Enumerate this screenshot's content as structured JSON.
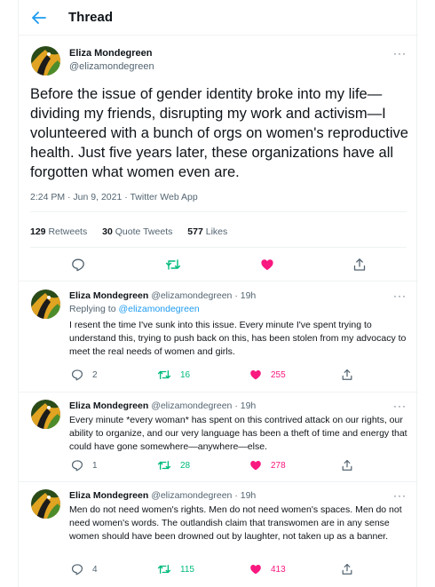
{
  "header": {
    "title": "Thread"
  },
  "main": {
    "author_name": "Eliza Mondegreen",
    "author_handle": "@elizamondegreen",
    "more": "···",
    "text": "Before the issue of gender identity broke into my life—dividing my friends, disrupting my work and activism—I volunteered with a bunch of orgs on women's reproductive health. Just five years later, these organizations have all forgotten what women even are.",
    "meta": "2:24 PM · Jun 9, 2021 · Twitter Web App",
    "stats": {
      "retweets_count": "129",
      "retweets_label": "Retweets",
      "quotes_count": "30",
      "quotes_label": "Quote Tweets",
      "likes_count": "577",
      "likes_label": "Likes"
    }
  },
  "replies": [
    {
      "author_name": "Eliza Mondegreen",
      "author_handle": "@elizamondegreen",
      "time": "· 19h",
      "more": "···",
      "replying_prefix": "Replying to",
      "replying_to": "@elizamondegreen",
      "text": "I resent the time I've sunk into this issue. Every minute I've spent trying to understand this, trying to push back on this, has been stolen from my advocacy to meet the real needs of women and girls.",
      "replies": "2",
      "retweets": "16",
      "likes": "255"
    },
    {
      "author_name": "Eliza Mondegreen",
      "author_handle": "@elizamondegreen",
      "time": "· 19h",
      "more": "···",
      "text": "Every minute *every woman* has spent on this contrived attack on our rights, our ability to organize, and our very language has been a theft of time and energy that could have gone somewhere—anywhere—else.",
      "replies": "1",
      "retweets": "28",
      "likes": "278"
    },
    {
      "author_name": "Eliza Mondegreen",
      "author_handle": "@elizamondegreen",
      "time": "· 19h",
      "more": "···",
      "text": "Men do not need women's rights. Men do not need women's spaces. Men do not need women's words. The outlandish claim that transwomen are in any sense women should have been drowned out by laughter, not taken up as a banner.",
      "replies": "4",
      "retweets": "115",
      "likes": "413"
    }
  ],
  "colors": {
    "accent": "#1d9bf0",
    "like": "#f91880",
    "retweet": "#00ba7c",
    "muted": "#536471"
  },
  "icons": [
    "back-arrow-icon",
    "more-icon",
    "reply-icon",
    "retweet-icon",
    "like-icon",
    "share-icon"
  ]
}
